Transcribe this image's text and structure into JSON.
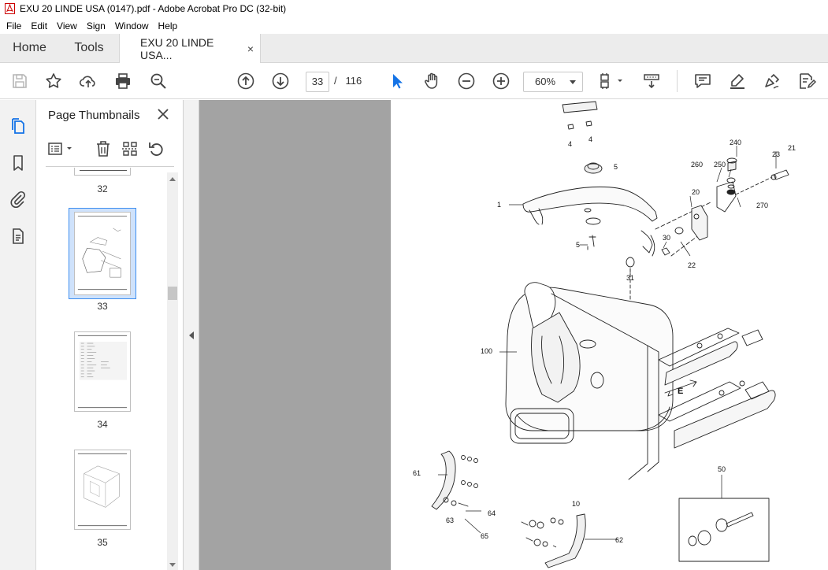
{
  "window": {
    "title": "EXU 20 LINDE USA (0147).pdf - Adobe Acrobat Pro DC (32-bit)"
  },
  "menu": [
    "File",
    "Edit",
    "View",
    "Sign",
    "Window",
    "Help"
  ],
  "tabs": {
    "home": "Home",
    "tools": "Tools",
    "document": "EXU 20 LINDE USA...",
    "close": "×"
  },
  "toolbar": {
    "page_current": "33",
    "page_separator": "/",
    "page_total": "116",
    "zoom": "60%"
  },
  "thumbnails_panel": {
    "title": "Page Thumbnails",
    "close": "✕",
    "pages": [
      {
        "label": "32",
        "selected": false
      },
      {
        "label": "33",
        "selected": true
      },
      {
        "label": "34",
        "selected": false
      },
      {
        "label": "35",
        "selected": false
      }
    ]
  },
  "drawing": {
    "callouts": [
      "4",
      "4",
      "5",
      "240",
      "23",
      "21",
      "260",
      "250",
      "20",
      "270",
      "1",
      "5",
      "30",
      "22",
      "31",
      "100",
      "E",
      "61",
      "64",
      "63",
      "65",
      "10",
      "50",
      "62"
    ]
  },
  "colors": {
    "accent": "#1473e6",
    "doc_background": "#a3a3a3",
    "selected_thumb": "#3d8ef0"
  }
}
